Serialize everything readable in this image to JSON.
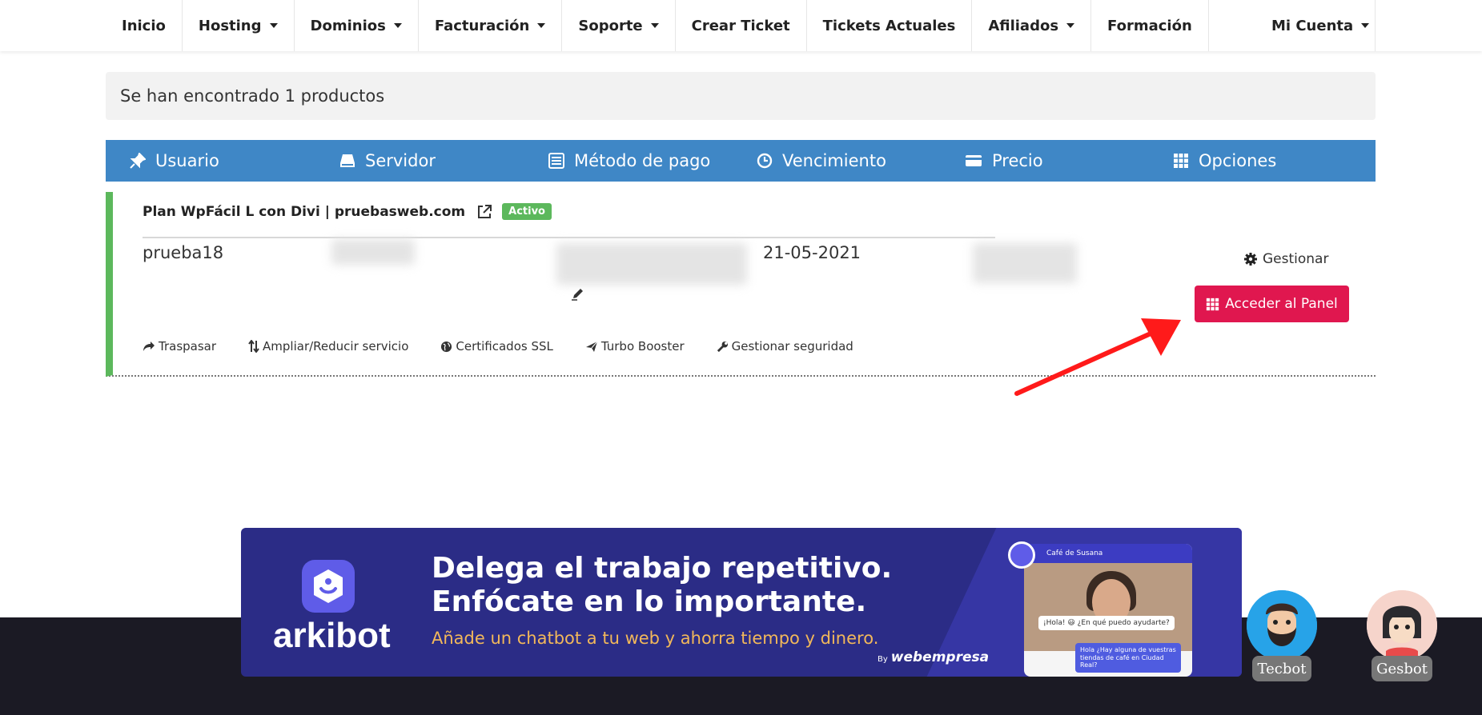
{
  "nav": {
    "items": [
      {
        "label": "Inicio",
        "caret": false
      },
      {
        "label": "Hosting",
        "caret": true
      },
      {
        "label": "Dominios",
        "caret": true
      },
      {
        "label": "Facturación",
        "caret": true
      },
      {
        "label": "Soporte",
        "caret": true
      },
      {
        "label": "Crear Ticket",
        "caret": false
      },
      {
        "label": "Tickets Actuales",
        "caret": false
      },
      {
        "label": "Afiliados",
        "caret": true
      },
      {
        "label": "Formación",
        "caret": false
      }
    ],
    "account": "Mi Cuenta"
  },
  "found_text": "Se han encontrado 1 productos",
  "table_headers": {
    "usuario": "Usuario",
    "servidor": "Servidor",
    "metodo": "Método de pago",
    "vencimiento": "Vencimiento",
    "precio": "Precio",
    "opciones": "Opciones"
  },
  "product": {
    "title": "Plan WpFácil L con Divi | pruebasweb.com",
    "status": "Activo",
    "user": "prueba18",
    "expiry": "21-05-2021",
    "manage": "Gestionar",
    "panel_button": "Acceder al Panel",
    "actions": {
      "transfer": "Traspasar",
      "resize": "Ampliar/Reducir servicio",
      "ssl": "Certificados SSL",
      "turbo": "Turbo Booster",
      "security": "Gestionar seguridad"
    }
  },
  "banner": {
    "brand": "arkibot",
    "headline1": "Delega el trabajo repetitivo.",
    "headline2": "Enfócate en lo importante.",
    "subline": "Añade un chatbot a tu web y ahorra tiempo y dinero.",
    "by": "By",
    "by_brand": "webempresa",
    "chat_title": "Café de Susana",
    "chat_msg1": "¡Hola! 😃 ¿En qué puedo ayudarte?",
    "chat_msg2": "Hola ¿Hay alguna de vuestras tiendas de café en Ciudad Real?"
  },
  "bots": {
    "tecbot": "Tecbot",
    "gesbot": "Gesbot"
  },
  "colors": {
    "header_blue": "#3f87c6",
    "active_green": "#5cb85c",
    "panel_button": "#e0174f",
    "banner_bg": "#2b2c86",
    "footer_bg": "#1b1a24",
    "arrow_red": "#ff1a1a"
  }
}
